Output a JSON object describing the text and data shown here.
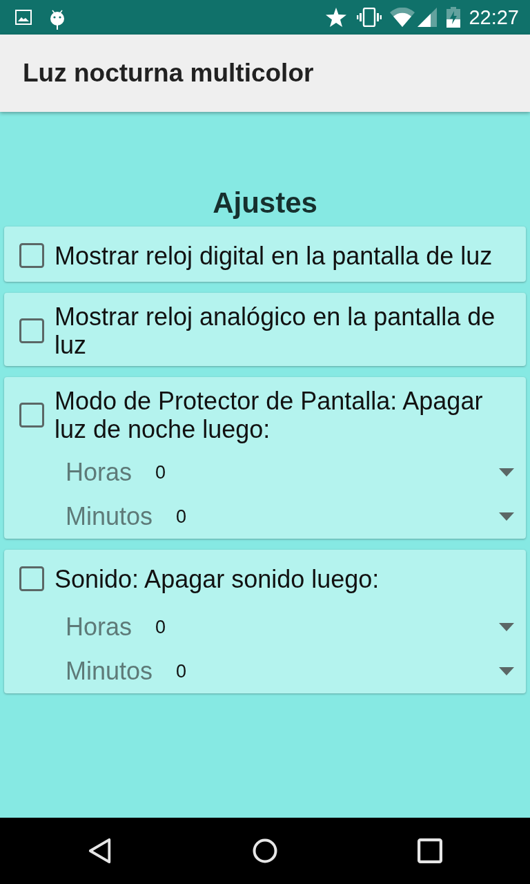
{
  "status_bar": {
    "time": "22:27"
  },
  "app_bar": {
    "title": "Luz nocturna multicolor"
  },
  "heading": "Ajustes",
  "settings": [
    {
      "label": "Mostrar reloj digital en la pantalla de luz",
      "checked": false
    },
    {
      "label": "Mostrar reloj analógico en la pantalla de luz",
      "checked": false
    },
    {
      "label": "Modo de Protector de Pantalla: Apagar luz de noche luego:",
      "checked": false,
      "spinners": [
        {
          "label": "Horas",
          "value": "0"
        },
        {
          "label": "Minutos",
          "value": "0"
        }
      ]
    },
    {
      "label": "Sonido: Apagar sonido luego:",
      "checked": false,
      "spinners": [
        {
          "label": "Horas",
          "value": "0"
        },
        {
          "label": "Minutos",
          "value": "0"
        }
      ]
    }
  ]
}
